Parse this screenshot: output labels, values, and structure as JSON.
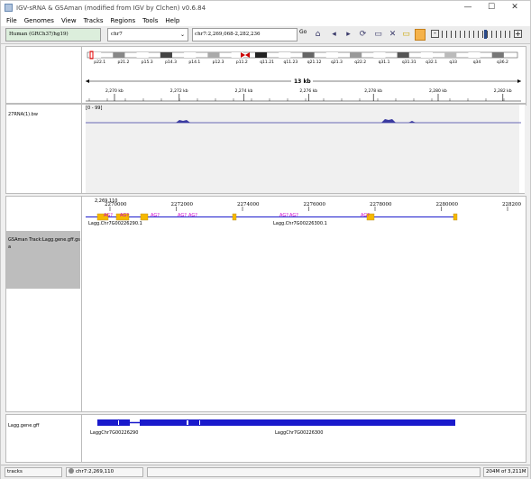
{
  "window": {
    "title": "IGV-sRNA & GSAman (modified from IGV by Clchen) v0.6.84",
    "minimize_glyph": "—",
    "maximize_glyph": "☐",
    "close_glyph": "✕"
  },
  "menu": [
    "File",
    "Genomes",
    "View",
    "Tracks",
    "Regions",
    "Tools",
    "Help"
  ],
  "toolbar": {
    "genome": "Human (GRCh37/hg19)",
    "chromosome": "chr7",
    "locus": "chr7:2,269,068-2,282,236",
    "go_label": "Go",
    "icons": [
      "home-icon",
      "back-icon",
      "forward-icon",
      "refresh-icon",
      "region-icon",
      "resize-icon",
      "close-tracks-icon",
      "popup-info-icon",
      "ruler-icon"
    ]
  },
  "ideogram": {
    "bands": [
      "p22.1",
      "p21.2",
      "p15.3",
      "p14.3",
      "p14.1",
      "p12.3",
      "p11.2",
      "q11.21",
      "q11.23",
      "q21.12",
      "q21.3",
      "q22.2",
      "q31.1",
      "q31.31",
      "q32.1",
      "q33",
      "q34",
      "q36.2"
    ]
  },
  "ruler": {
    "span_label": "13 kb",
    "ticks": [
      "2,270 kb",
      "2,272 kb",
      "2,274 kb",
      "2,276 kb",
      "2,278 kb",
      "2,280 kb",
      "2,282 kb"
    ]
  },
  "track1": {
    "name": "27RNA(1).bw",
    "range": "[0 - 99]"
  },
  "gsaman": {
    "name": "GSAman Track:Lagg.gene.gff.gs a",
    "ruler_first": "2,269,110",
    "ruler_ticks": [
      "2270000",
      "2272000",
      "2274000",
      "2276000",
      "2278000",
      "2280000",
      "228200"
    ],
    "features": [
      "Lagg.Chr7G00226290.1",
      "Lagg.Chr7G00226300.1"
    ],
    "sirna_labels": [
      "AG?",
      "AG?",
      "AG?",
      "AG?",
      "AG?",
      "AG?",
      "AG?",
      "AG?"
    ]
  },
  "gene_track": {
    "name": "Lagg.gene.gff",
    "genes": [
      "LaggChr7G00226290",
      "LaggChr7G00226300"
    ]
  },
  "status": {
    "tracks_label": "tracks",
    "position": "chr7:2,269,110",
    "memory": "204M of 3,211M"
  },
  "colors": {
    "gene": "#1a1acc",
    "exon_orange": "#f5b800",
    "sirna_text": "#cc00cc",
    "signal": "#3a3aa0"
  }
}
